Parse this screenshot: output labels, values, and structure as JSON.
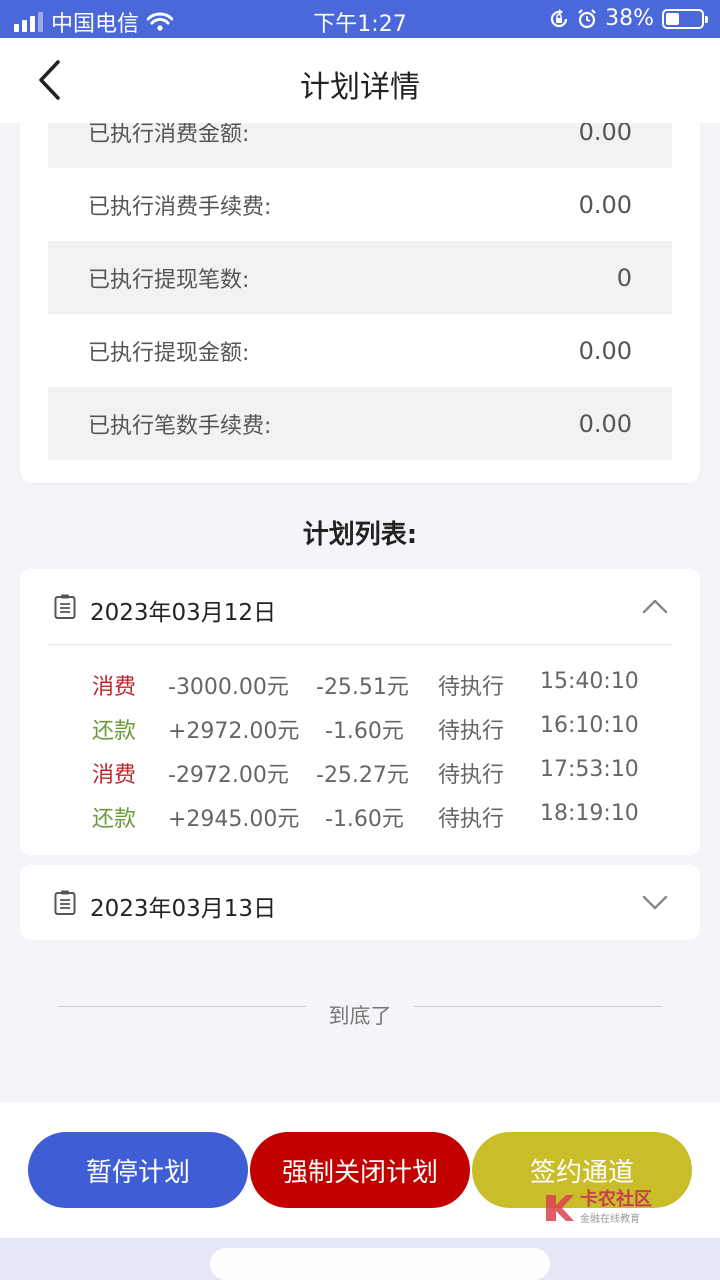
{
  "colors": {
    "status_bar": "#4a68d9",
    "consume": "#c0272d",
    "repay": "#6b9b3a",
    "btn_pause": "#3f5ed6",
    "btn_close": "#c20000",
    "btn_sign": "#c9bd2a"
  },
  "status_bar": {
    "carrier": "中国电信",
    "time": "下午1:27",
    "battery": "38%",
    "battery_level": 0.38,
    "icons": [
      "signal-icon",
      "wifi-icon",
      "rotation-lock-icon",
      "alarm-icon",
      "battery-icon"
    ]
  },
  "nav": {
    "title": "计划详情",
    "back_icon": "chevron-left-icon"
  },
  "summary": [
    {
      "label": "已执行消费金额:",
      "value": "0.00"
    },
    {
      "label": "已执行消费手续费:",
      "value": "0.00"
    },
    {
      "label": "已执行提现笔数:",
      "value": "0"
    },
    {
      "label": "已执行提现金额:",
      "value": "0.00"
    },
    {
      "label": "已执行笔数手续费:",
      "value": "0.00"
    }
  ],
  "plan_list": {
    "title": "计划列表:",
    "days": [
      {
        "date": "2023年03月12日",
        "expanded": true,
        "transactions": [
          {
            "type": "消费",
            "kind": "consume",
            "amount": "-3000.00元",
            "fee": "-25.51元",
            "status": "待执行",
            "time": "15:40:10"
          },
          {
            "type": "还款",
            "kind": "repay",
            "amount": "+2972.00元",
            "fee": "-1.60元",
            "status": "待执行",
            "time": "16:10:10"
          },
          {
            "type": "消费",
            "kind": "consume",
            "amount": "-2972.00元",
            "fee": "-25.27元",
            "status": "待执行",
            "time": "17:53:10"
          },
          {
            "type": "还款",
            "kind": "repay",
            "amount": "+2945.00元",
            "fee": "-1.60元",
            "status": "待执行",
            "time": "18:19:10"
          }
        ]
      },
      {
        "date": "2023年03月13日",
        "expanded": false,
        "transactions": []
      }
    ]
  },
  "end_text": "到底了",
  "actions": {
    "pause": "暂停计划",
    "force_close": "强制关闭计划",
    "sign": "签约通道"
  },
  "watermark": {
    "name": "卡农社区",
    "slogan": "金融在线教育"
  }
}
